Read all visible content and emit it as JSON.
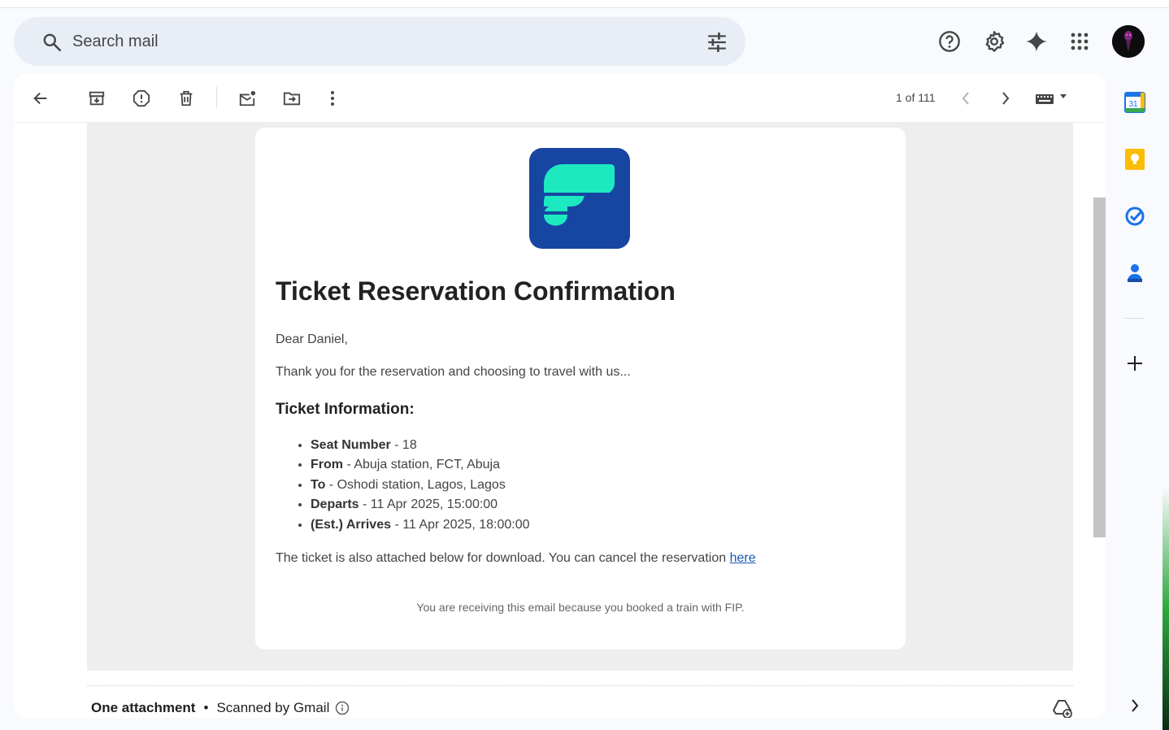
{
  "search": {
    "placeholder": "Search mail"
  },
  "toolbar": {
    "count": "1 of 111",
    "buttons": [
      "back-icon",
      "archive-icon",
      "report-spam-icon",
      "delete-icon",
      "mark-unread-icon",
      "move-to-icon",
      "more-icon",
      "newer-icon",
      "older-icon",
      "keyboard-icon"
    ]
  },
  "email": {
    "title": "Ticket Reservation Confirmation",
    "greeting": "Dear Daniel,",
    "intro": "Thank you for the reservation and choosing to travel with us...",
    "section_heading": "Ticket Information:",
    "details": [
      {
        "label": "Seat Number",
        "value": " - 18"
      },
      {
        "label": "From",
        "value": " - Abuja station, FCT, Abuja"
      },
      {
        "label": "To",
        "value": " - Oshodi station, Lagos, Lagos"
      },
      {
        "label": "Departs",
        "value": " - 11 Apr 2025, 15:00:00"
      },
      {
        "label": "(Est.) Arrives",
        "value": " - 11 Apr 2025, 18:00:00"
      }
    ],
    "download_text": "The ticket is also attached below for download. You can cancel the reservation ",
    "cancel_link": "here",
    "footer": "You are receiving this email because you booked a train with FIP.",
    "brand_colors": {
      "logo_bg": "#1746a2",
      "logo_mark": "#1de9c0"
    }
  },
  "attachments": {
    "label": "One attachment",
    "separator": "•",
    "scan": "Scanned by Gmail"
  },
  "side_panel": [
    "calendar-icon",
    "keep-icon",
    "tasks-icon",
    "contacts-icon",
    "add-icon",
    "expand-icon"
  ],
  "calendar_day": "31"
}
